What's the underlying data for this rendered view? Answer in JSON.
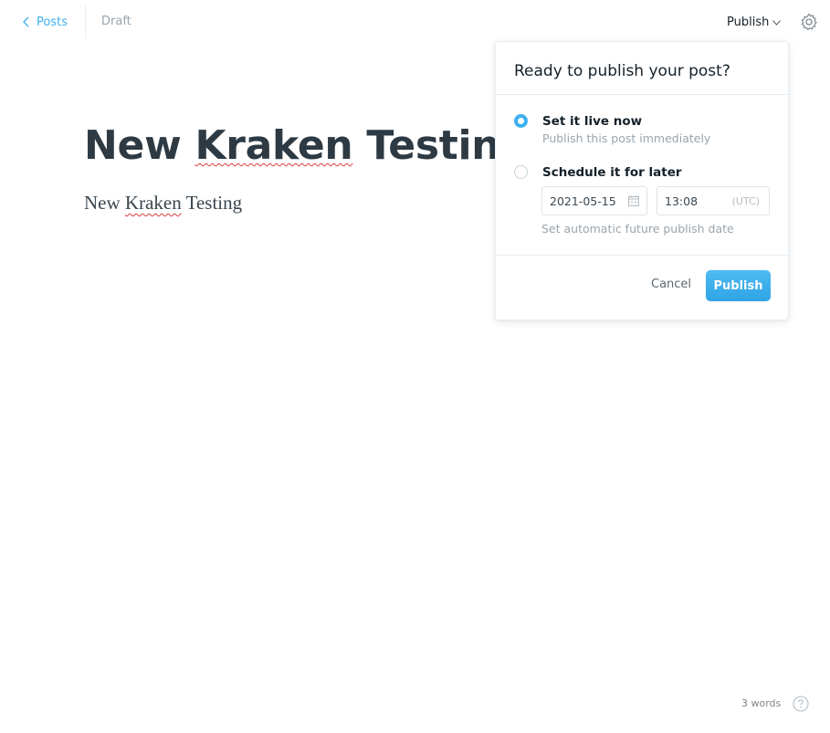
{
  "header": {
    "back_label": "Posts",
    "status": "Draft",
    "publish_menu_label": "Publish"
  },
  "editor": {
    "title_words": [
      "New",
      "Kraken",
      "Testing"
    ],
    "body_words": [
      "New",
      "Kraken",
      "Testing"
    ]
  },
  "publish_popover": {
    "title": "Ready to publish your post?",
    "options": [
      {
        "label": "Set it live now",
        "description": "Publish this post immediately",
        "selected": true
      },
      {
        "label": "Schedule it for later",
        "selected": false
      }
    ],
    "date_value": "2021-05-15",
    "time_value": "13:08",
    "timezone": "(UTC)",
    "schedule_hint": "Set automatic future publish date",
    "cancel_label": "Cancel",
    "publish_label": "Publish"
  },
  "footer": {
    "word_count": "3 words"
  },
  "colors": {
    "accent": "#3eb0ef",
    "text": "#15212a",
    "muted": "#9aa5ad",
    "spellcheck": "#e03a3a"
  },
  "icons": [
    "chevron-left-icon",
    "chevron-down-icon",
    "gear-icon",
    "calendar-icon",
    "help-icon"
  ]
}
